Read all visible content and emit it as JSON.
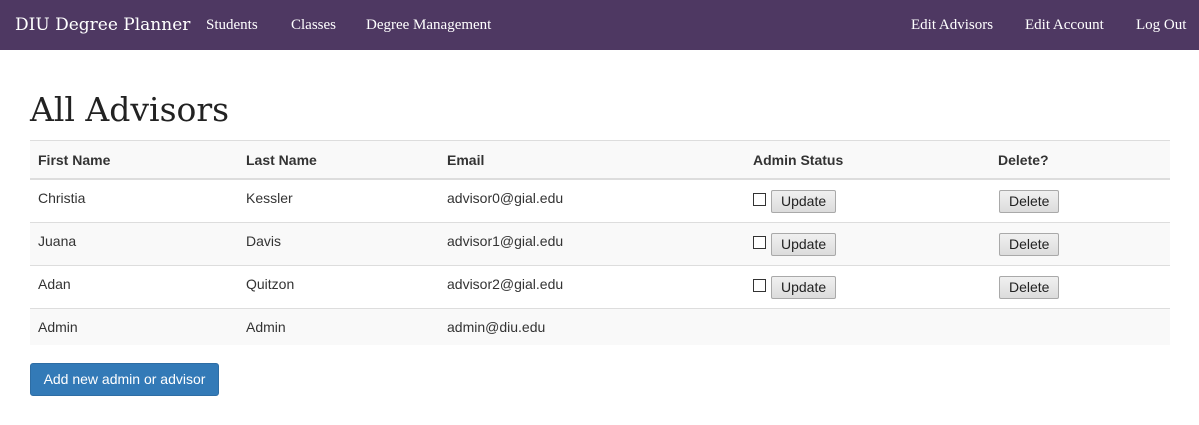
{
  "navbar": {
    "brand": "DIU Degree Planner",
    "left_links": [
      "Students",
      "Classes",
      "Degree Management"
    ],
    "right_links": [
      "Edit Advisors",
      "Edit Account",
      "Log Out"
    ],
    "background_color": "#4e3862"
  },
  "page": {
    "title": "All Advisors"
  },
  "table": {
    "headers": [
      "First Name",
      "Last Name",
      "Email",
      "Admin Status",
      "Delete?"
    ],
    "rows": [
      {
        "first_name": "Christia",
        "last_name": "Kessler",
        "email": "advisor0@gial.edu",
        "admin_checked": false,
        "update_label": "Update",
        "delete_label": "Delete"
      },
      {
        "first_name": "Juana",
        "last_name": "Davis",
        "email": "advisor1@gial.edu",
        "admin_checked": false,
        "update_label": "Update",
        "delete_label": "Delete"
      },
      {
        "first_name": "Adan",
        "last_name": "Quitzon",
        "email": "advisor2@gial.edu",
        "admin_checked": false,
        "update_label": "Update",
        "delete_label": "Delete"
      },
      {
        "first_name": "Admin",
        "last_name": "Admin",
        "email": "admin@diu.edu"
      }
    ]
  },
  "actions": {
    "add_button_label": "Add new admin or advisor",
    "add_button_color": "#337ab7"
  }
}
